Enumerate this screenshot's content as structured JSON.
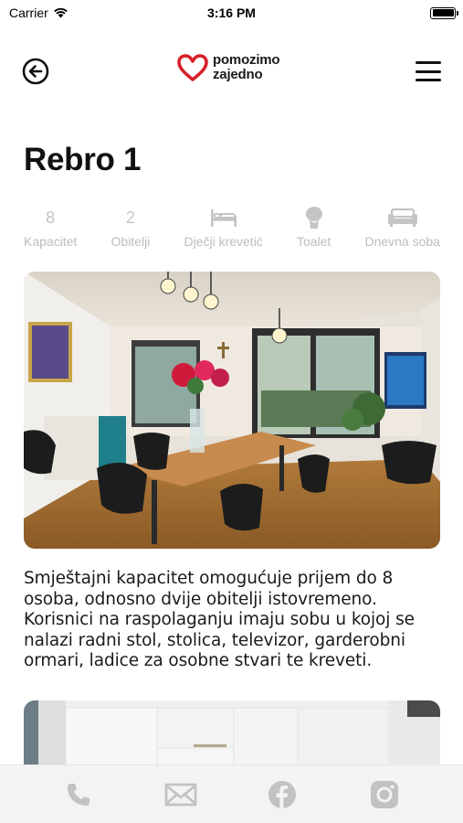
{
  "status_bar": {
    "carrier": "Carrier",
    "time": "3:16 PM"
  },
  "header": {
    "logo_line1": "pomozimo",
    "logo_line2": "zajedno",
    "brand_color": "#d7212b"
  },
  "page": {
    "title": "Rebro 1"
  },
  "stats": [
    {
      "value": "8",
      "label": "Kapacitet"
    },
    {
      "value": "2",
      "label": "Obitelji"
    },
    {
      "icon": "bed-icon",
      "label": "Dječji krevetić"
    },
    {
      "icon": "toilet-icon",
      "label": "Toalet"
    },
    {
      "icon": "sofa-icon",
      "label": "Dnevna soba"
    }
  ],
  "description": "Smještajni kapacitet omogućuje prijem do 8 osoba, odnosno dvije obitelji istovremeno. Korisnici na raspolaganju imaju sobu u kojoj se nalazi radni stol, stolica, televizor, garderobni ormari, ladice za osobne stvari te kreveti.",
  "footer": {
    "icons": [
      "phone-icon",
      "mail-icon",
      "facebook-icon",
      "instagram-icon"
    ],
    "icon_color": "#c2c2c2"
  }
}
